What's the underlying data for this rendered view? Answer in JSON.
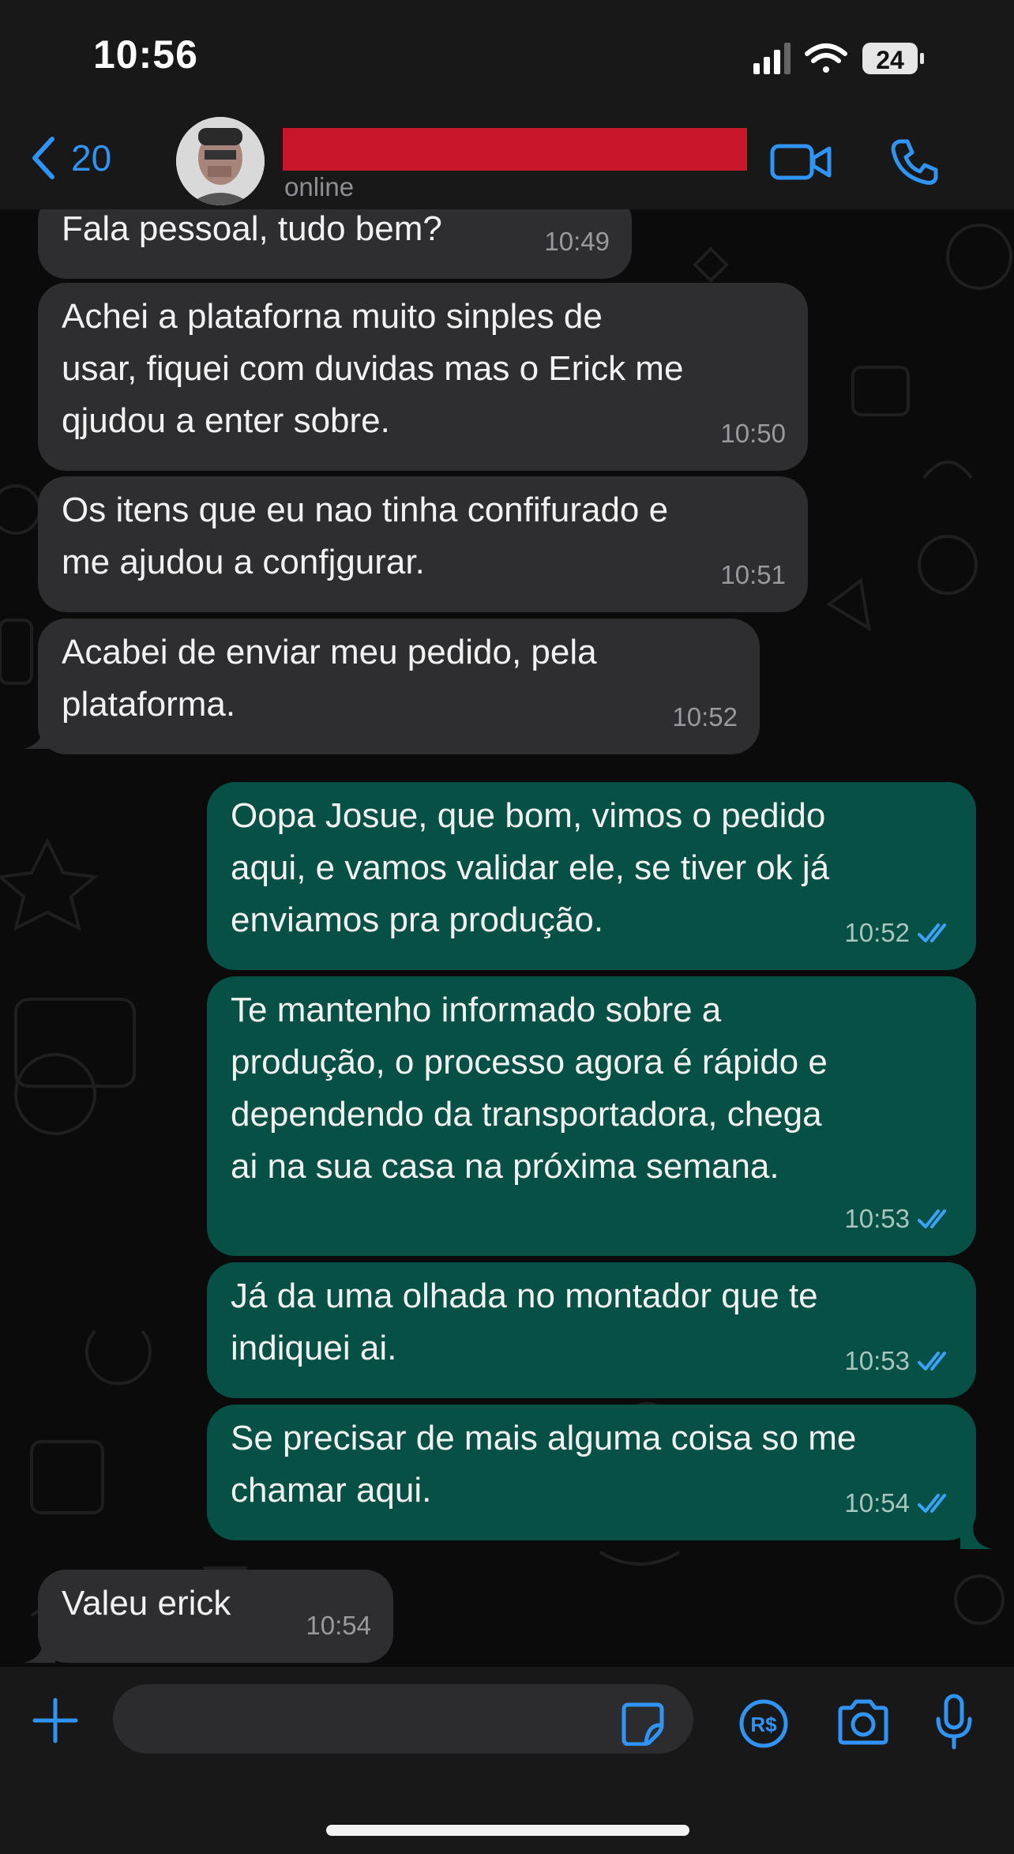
{
  "status_bar": {
    "time": "10:56",
    "battery": "24"
  },
  "header": {
    "back_count": "20",
    "presence": "online"
  },
  "messages": [
    {
      "direction": "in",
      "text": "Fala pessoal, tudo bem?",
      "time": "10:49"
    },
    {
      "direction": "in",
      "text": "Achei a plataforna muito sinples de\nusar, fiquei com duvidas mas o Erick me\nqjudou a enter sobre.",
      "time": "10:50"
    },
    {
      "direction": "in",
      "text": "Os itens que eu nao tinha confifurado e\nme ajudou a confjgurar.",
      "time": "10:51"
    },
    {
      "direction": "in",
      "text": "Acabei de enviar meu pedido, pela\nplataforma.",
      "time": "10:52"
    },
    {
      "direction": "out",
      "text": "Oopa Josue, que bom, vimos o pedido\naqui, e vamos validar ele, se tiver ok já\nenviamos pra produção.",
      "time": "10:52"
    },
    {
      "direction": "out",
      "text": "Te mantenho informado sobre a\nprodução, o processo agora é rápido e\ndependendo da transportadora, chega\nai na sua casa na próxima semana.",
      "time": "10:53"
    },
    {
      "direction": "out",
      "text": "Já da uma olhada no montador que te\nindiquei ai.",
      "time": "10:53"
    },
    {
      "direction": "out",
      "text": "Se precisar de mais alguma coisa so me\nchamar aqui.",
      "time": "10:54"
    },
    {
      "direction": "in",
      "text": "Valeu erick",
      "time": "10:54"
    }
  ],
  "colors": {
    "accent": "#2f94f5",
    "incoming_bubble": "#2e2e30",
    "outgoing_bubble": "#075045",
    "redaction": "#c8172a",
    "read_receipt": "#3aa3ff"
  },
  "icons": {
    "back": "chevron-left-icon",
    "video": "video-camera-icon",
    "call": "phone-icon",
    "attach": "plus-icon",
    "sticker": "sticker-icon",
    "payment": "pix-payment-icon",
    "camera": "camera-icon",
    "mic": "microphone-icon",
    "read": "double-check-icon"
  }
}
